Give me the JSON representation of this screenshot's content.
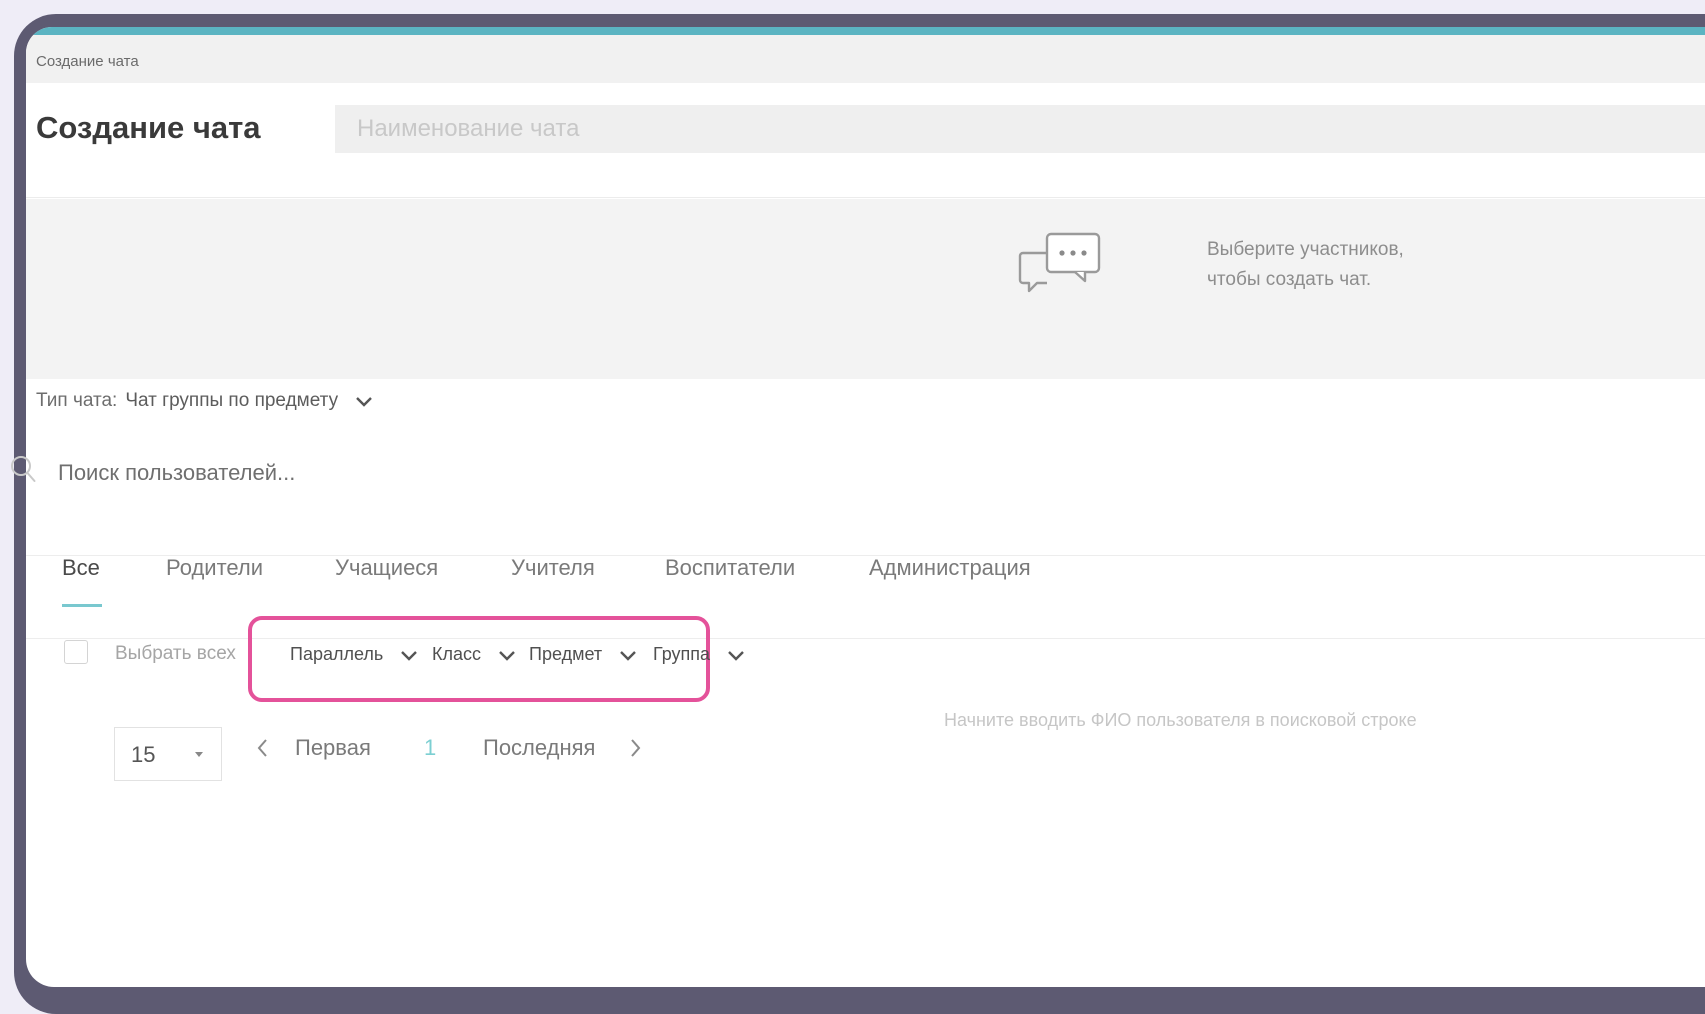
{
  "breadcrumb": "Создание чата",
  "page_title": "Создание чата",
  "chat_name_placeholder": "Наименование чата",
  "hint": {
    "line1": "Выберите участников,",
    "line2": "чтобы создать чат."
  },
  "chat_type": {
    "label": "Тип чата:",
    "value": "Чат группы по предмету"
  },
  "search_placeholder": "Поиск пользователей...",
  "tabs": [
    "Все",
    "Родители",
    "Учащиеся",
    "Учителя",
    "Воспитатели",
    "Администрация"
  ],
  "active_tab": "Все",
  "select_all_label": "Выбрать всех",
  "filters": [
    "Параллель",
    "Класс",
    "Предмет",
    "Группа"
  ],
  "page_size": "15",
  "pagination": {
    "first": "Первая",
    "current": "1",
    "last": "Последняя"
  },
  "empty_message": "Начните вводить ФИО пользователя в поисковой строке",
  "colors": {
    "accent": "#5bb4c2",
    "highlight": "#e4529a",
    "frame": "#5d5a72"
  }
}
